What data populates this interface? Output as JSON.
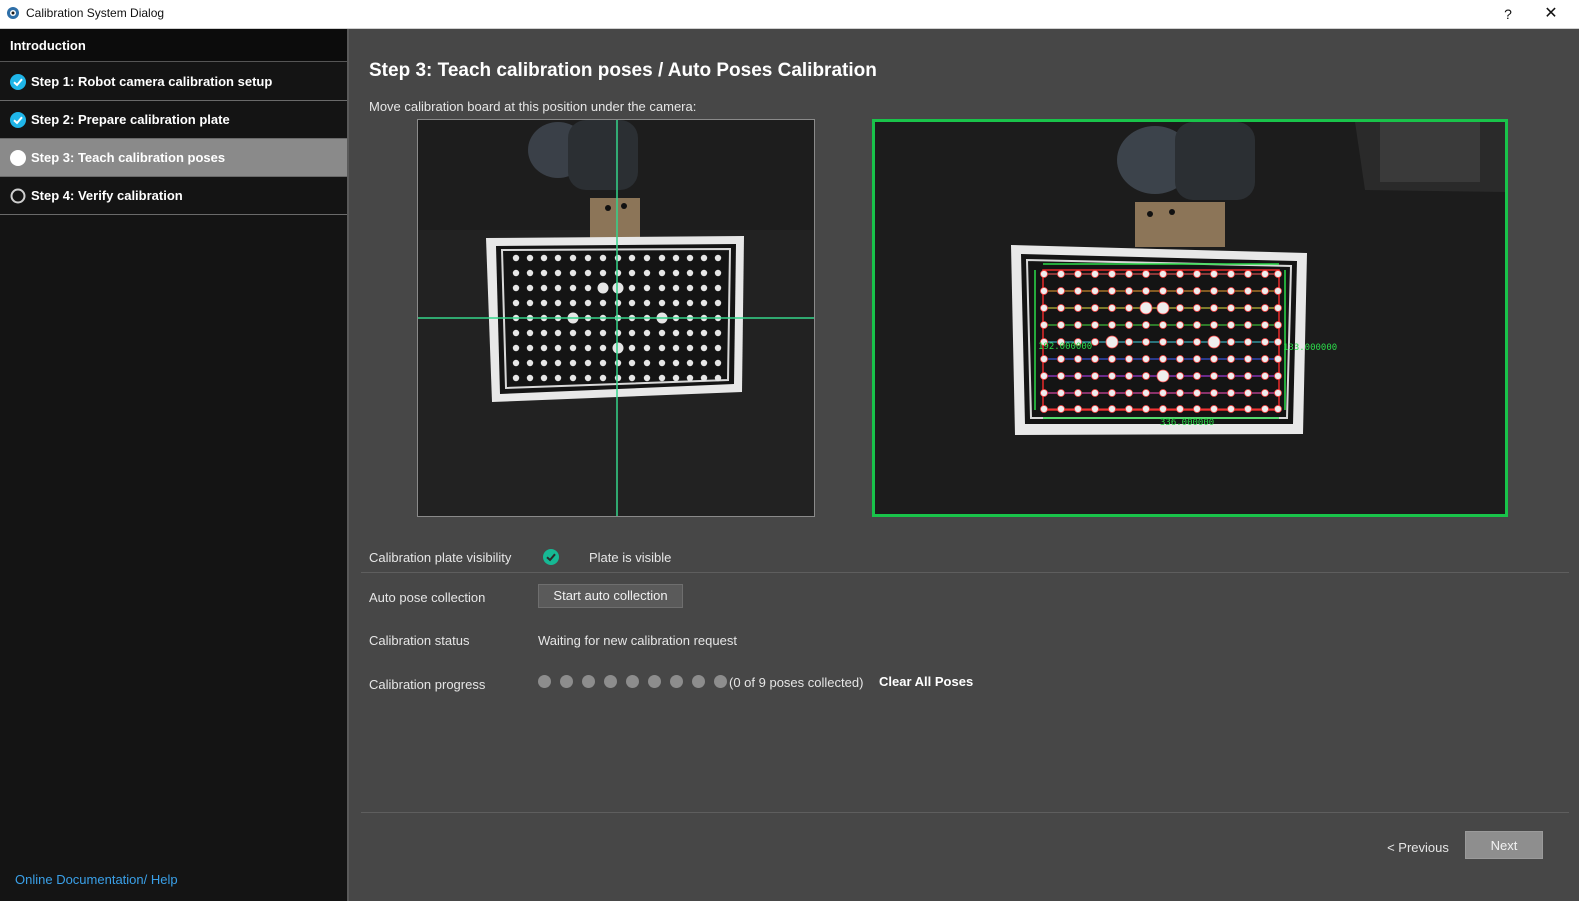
{
  "window": {
    "title": "Calibration System Dialog",
    "help_label": "?",
    "close_label": "✕"
  },
  "sidebar": {
    "intro_label": "Introduction",
    "steps": [
      {
        "label": "Step 1: Robot camera calibration setup",
        "state": "done"
      },
      {
        "label": "Step 2: Prepare calibration plate",
        "state": "done"
      },
      {
        "label": "Step 3: Teach calibration poses",
        "state": "active"
      },
      {
        "label": "Step 4: Verify calibration",
        "state": "pending"
      }
    ],
    "help_link": "Online Documentation/ Help"
  },
  "main": {
    "heading": "Step 3: Teach calibration poses / Auto Poses Calibration",
    "instruction": "Move calibration board at this position under the camera:",
    "overlay_labels": [
      "192.000000",
      "133.000000",
      "336.000000"
    ],
    "visibility_label": "Calibration plate visibility",
    "visibility_value": "Plate is visible",
    "auto_label": "Auto pose collection",
    "auto_button": "Start auto collection",
    "status_label": "Calibration status",
    "status_value": "Waiting for new calibration request",
    "progress_label": "Calibration progress",
    "progress": {
      "collected": 0,
      "total": 9
    },
    "progress_text": "(0 of 9 poses collected)",
    "clear_button": "Clear All Poses"
  },
  "footer": {
    "previous_label": "< Previous",
    "next_label": "Next"
  },
  "colors": {
    "accent_check": "#1fb5e8",
    "visible_ok": "#16b894",
    "target_frame": "#19c34a",
    "crosshair": "#34d48a",
    "link": "#3aa0e8"
  }
}
